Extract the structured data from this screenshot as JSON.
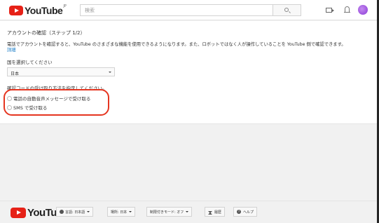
{
  "header": {
    "logo_text": "YouTube",
    "logo_sup": "JP",
    "search_placeholder": "検索"
  },
  "verification": {
    "title": "アカウントの確認（ステップ 1/2）",
    "description": "電話でアカウントを確認すると、YouTube のさまざまな機能を使用できるようになります。また、ロボットではなく人が操作していることを YouTube 側で確認できます。",
    "details_link": "詳細",
    "country_label": "国を選択してください",
    "country_value": "日本",
    "method_label": "確認コードの受け取り方法を指定してください。",
    "options": [
      {
        "label": "電話の自動音声メッセージで受け取る",
        "selected": false
      },
      {
        "label": "SMS で受け取る",
        "selected": false
      }
    ]
  },
  "footer": {
    "logo_text": "YouTube",
    "language": "言語: 日本語",
    "location": "場所: 日本",
    "restricted_mode": "制限付きモード: オフ",
    "history": "履歴",
    "help": "ヘルプ"
  },
  "colors": {
    "brand_red": "#e62117",
    "link_blue": "#167ac6",
    "highlight_red": "#e53520"
  }
}
